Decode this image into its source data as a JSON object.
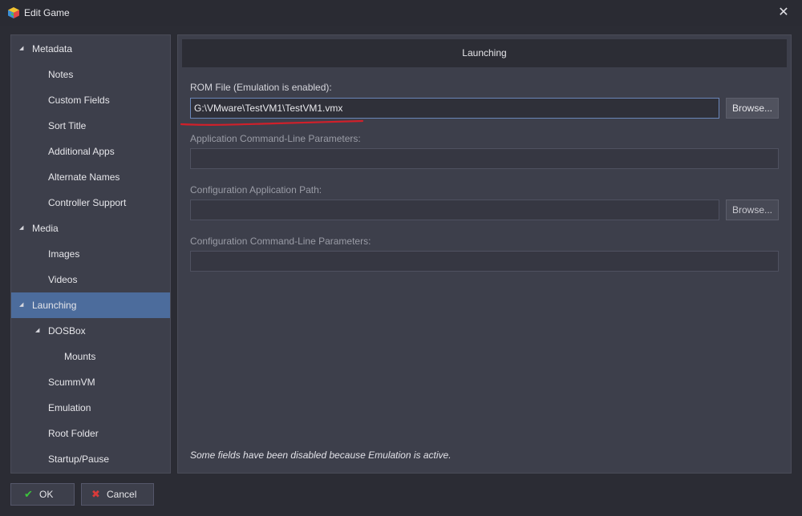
{
  "window": {
    "title": "Edit Game",
    "close_glyph": "✕",
    "app_icon": "launchbox-cube-icon"
  },
  "sidebar": {
    "items": [
      {
        "label": "Metadata",
        "level": 0,
        "expanded": true
      },
      {
        "label": "Notes",
        "level": 1
      },
      {
        "label": "Custom Fields",
        "level": 1
      },
      {
        "label": "Sort Title",
        "level": 1
      },
      {
        "label": "Additional Apps",
        "level": 1
      },
      {
        "label": "Alternate Names",
        "level": 1
      },
      {
        "label": "Controller Support",
        "level": 1
      },
      {
        "label": "Media",
        "level": 0,
        "expanded": true
      },
      {
        "label": "Images",
        "level": 1
      },
      {
        "label": "Videos",
        "level": 1
      },
      {
        "label": "Launching",
        "level": 0,
        "expanded": true,
        "selected": true
      },
      {
        "label": "DOSBox",
        "level": 1,
        "expanded": true
      },
      {
        "label": "Mounts",
        "level": 2
      },
      {
        "label": "ScummVM",
        "level": 1
      },
      {
        "label": "Emulation",
        "level": 1
      },
      {
        "label": "Root Folder",
        "level": 1
      },
      {
        "label": "Startup/Pause",
        "level": 1
      }
    ],
    "expand_glyph": "◢"
  },
  "main": {
    "header": "Launching",
    "rom_file": {
      "label": "ROM File (Emulation is enabled):",
      "value": "G:\\VMware\\TestVM1\\TestVM1.vmx",
      "browse_label": "Browse..."
    },
    "app_params": {
      "label": "Application Command-Line Parameters:",
      "value": ""
    },
    "config_path": {
      "label": "Configuration Application Path:",
      "value": "",
      "browse_label": "Browse..."
    },
    "config_params": {
      "label": "Configuration Command-Line Parameters:",
      "value": ""
    },
    "footer_note": "Some fields have been disabled because Emulation is active."
  },
  "buttons": {
    "ok": {
      "label": "OK",
      "icon": "check-icon",
      "glyph": "✔"
    },
    "cancel": {
      "label": "Cancel",
      "icon": "cancel-icon",
      "glyph": "✖"
    }
  },
  "colors": {
    "selection": "#4c6c9c",
    "annotation": "#d0202a",
    "ok_icon": "#3cc43c",
    "cancel_icon": "#d83a3a"
  }
}
